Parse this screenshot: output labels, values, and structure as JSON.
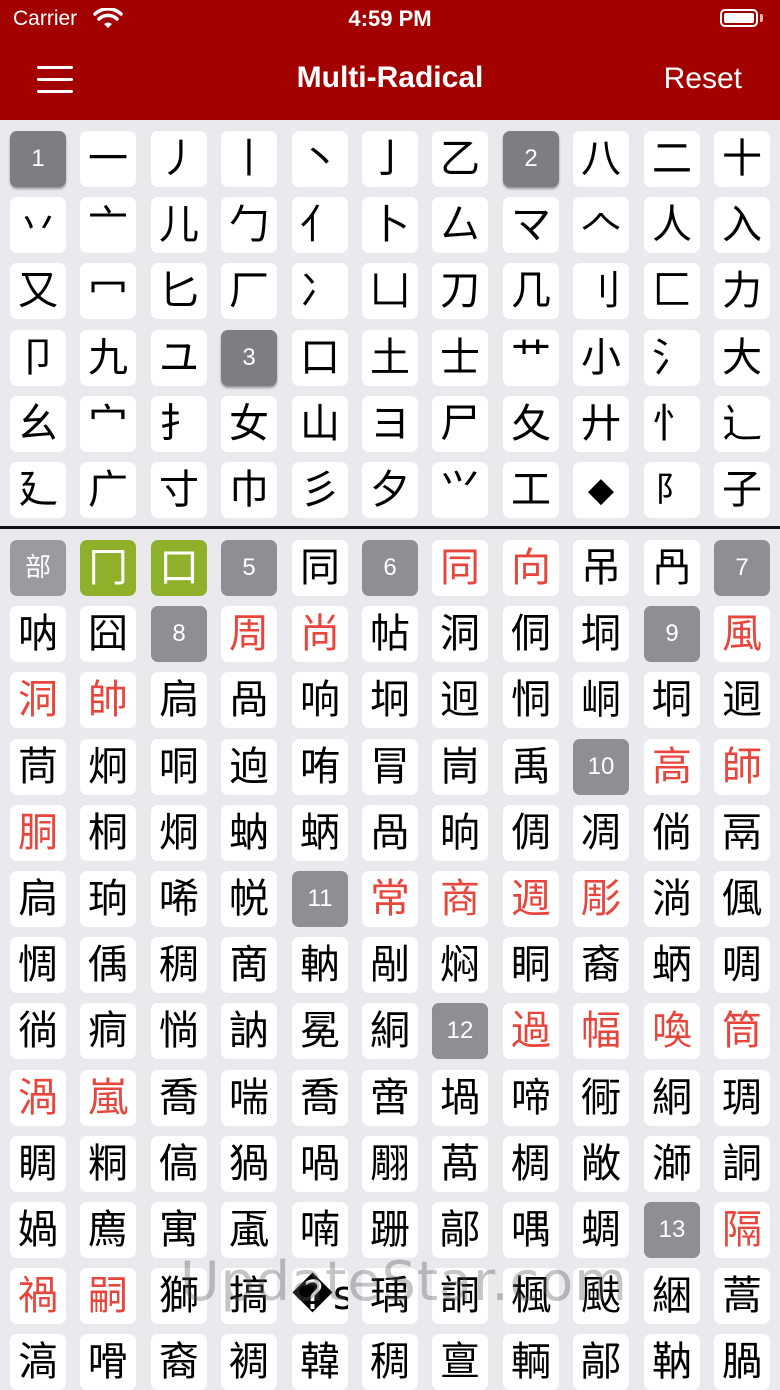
{
  "status_bar": {
    "carrier": "Carrier",
    "time": "4:59 PM"
  },
  "nav": {
    "title": "Multi-Radical",
    "reset_label": "Reset"
  },
  "colors": {
    "header_bg": "#a30000",
    "selected": "#8fb02a",
    "highlight_text": "#e8463c",
    "stroke_badge": "#8e8e93"
  },
  "icons": [
    "wifi-icon",
    "battery-icon",
    "hamburger-menu-icon"
  ],
  "radicals": [
    {
      "c": "1",
      "t": "num"
    },
    {
      "c": "一"
    },
    {
      "c": "丿"
    },
    {
      "c": "丨"
    },
    {
      "c": "丶"
    },
    {
      "c": "亅"
    },
    {
      "c": "乙"
    },
    {
      "c": "2",
      "t": "num"
    },
    {
      "c": "八"
    },
    {
      "c": "二"
    },
    {
      "c": "十"
    },
    {
      "c": "丷"
    },
    {
      "c": "亠"
    },
    {
      "c": "儿"
    },
    {
      "c": "勹"
    },
    {
      "c": "亻"
    },
    {
      "c": "卜"
    },
    {
      "c": "厶"
    },
    {
      "c": "マ"
    },
    {
      "c": "𠆢"
    },
    {
      "c": "人"
    },
    {
      "c": "入"
    },
    {
      "c": "又"
    },
    {
      "c": "冖"
    },
    {
      "c": "匕"
    },
    {
      "c": "厂"
    },
    {
      "c": "冫"
    },
    {
      "c": "凵"
    },
    {
      "c": "刀"
    },
    {
      "c": "几"
    },
    {
      "c": "刂"
    },
    {
      "c": "匚"
    },
    {
      "c": "力"
    },
    {
      "c": "卩"
    },
    {
      "c": "九"
    },
    {
      "c": "ユ"
    },
    {
      "c": "3",
      "t": "num"
    },
    {
      "c": "口"
    },
    {
      "c": "土"
    },
    {
      "c": "士"
    },
    {
      "c": "艹"
    },
    {
      "c": "小"
    },
    {
      "c": "氵"
    },
    {
      "c": "大"
    },
    {
      "c": "幺"
    },
    {
      "c": "宀"
    },
    {
      "c": "扌"
    },
    {
      "c": "女"
    },
    {
      "c": "山"
    },
    {
      "c": "ヨ"
    },
    {
      "c": "尸"
    },
    {
      "c": "夂"
    },
    {
      "c": "廾"
    },
    {
      "c": "忄"
    },
    {
      "c": "辶"
    },
    {
      "c": "廴"
    },
    {
      "c": "广"
    },
    {
      "c": "寸"
    },
    {
      "c": "巾"
    },
    {
      "c": "彡"
    },
    {
      "c": "夕"
    },
    {
      "c": "⺍"
    },
    {
      "c": "工"
    },
    {
      "c": "◆阝"
    },
    {
      "c": "阝◆"
    },
    {
      "c": "子"
    }
  ],
  "results": [
    {
      "c": "部",
      "t": "bu"
    },
    {
      "c": "冂",
      "t": "sel"
    },
    {
      "c": "口",
      "t": "sel"
    },
    {
      "c": "5",
      "t": "num"
    },
    {
      "c": "同"
    },
    {
      "c": "6",
      "t": "num"
    },
    {
      "c": "同",
      "t": "red"
    },
    {
      "c": "向",
      "t": "red"
    },
    {
      "c": "吊"
    },
    {
      "c": "冎"
    },
    {
      "c": "7",
      "t": "num"
    },
    {
      "c": "呐"
    },
    {
      "c": "囧"
    },
    {
      "c": "8",
      "t": "num"
    },
    {
      "c": "周",
      "t": "red"
    },
    {
      "c": "尚",
      "t": "red"
    },
    {
      "c": "帖"
    },
    {
      "c": "洞"
    },
    {
      "c": "侗"
    },
    {
      "c": "垌"
    },
    {
      "c": "9",
      "t": "num"
    },
    {
      "c": "風",
      "t": "red"
    },
    {
      "c": "洞",
      "t": "red"
    },
    {
      "c": "帥",
      "t": "red"
    },
    {
      "c": "扃"
    },
    {
      "c": "咼"
    },
    {
      "c": "响"
    },
    {
      "c": "坰"
    },
    {
      "c": "迥"
    },
    {
      "c": "恫"
    },
    {
      "c": "峒"
    },
    {
      "c": "垌"
    },
    {
      "c": "迵"
    },
    {
      "c": "茼"
    },
    {
      "c": "炯"
    },
    {
      "c": "哃"
    },
    {
      "c": "逈"
    },
    {
      "c": "哊"
    },
    {
      "c": "冐"
    },
    {
      "c": "峝"
    },
    {
      "c": "禹"
    },
    {
      "c": "10",
      "t": "num"
    },
    {
      "c": "高",
      "t": "red"
    },
    {
      "c": "師",
      "t": "red"
    },
    {
      "c": "胴",
      "t": "red"
    },
    {
      "c": "桐"
    },
    {
      "c": "烔"
    },
    {
      "c": "蚋"
    },
    {
      "c": "蛃"
    },
    {
      "c": "咼"
    },
    {
      "c": "晌"
    },
    {
      "c": "倜"
    },
    {
      "c": "凋"
    },
    {
      "c": "倘"
    },
    {
      "c": "鬲"
    },
    {
      "c": "扃"
    },
    {
      "c": "珦"
    },
    {
      "c": "唏"
    },
    {
      "c": "帨"
    },
    {
      "c": "11",
      "t": "num"
    },
    {
      "c": "常",
      "t": "red"
    },
    {
      "c": "商",
      "t": "red"
    },
    {
      "c": "週",
      "t": "red"
    },
    {
      "c": "彫",
      "t": "red"
    },
    {
      "c": "淌"
    },
    {
      "c": "偑"
    },
    {
      "c": "惆"
    },
    {
      "c": "偊"
    },
    {
      "c": "稠"
    },
    {
      "c": "啇"
    },
    {
      "c": "軜"
    },
    {
      "c": "剮"
    },
    {
      "c": "焖"
    },
    {
      "c": "眮"
    },
    {
      "c": "裔"
    },
    {
      "c": "蛃"
    },
    {
      "c": "啁"
    },
    {
      "c": "徜"
    },
    {
      "c": "痌"
    },
    {
      "c": "惝"
    },
    {
      "c": "訥"
    },
    {
      "c": "冕"
    },
    {
      "c": "絧"
    },
    {
      "c": "12",
      "t": "num"
    },
    {
      "c": "過",
      "t": "red"
    },
    {
      "c": "幅",
      "t": "red"
    },
    {
      "c": "喚",
      "t": "red"
    },
    {
      "c": "筒",
      "t": "red"
    },
    {
      "c": "渦",
      "t": "red"
    },
    {
      "c": "嵐",
      "t": "red"
    },
    {
      "c": "喬"
    },
    {
      "c": "喘"
    },
    {
      "c": "喬"
    },
    {
      "c": "啻"
    },
    {
      "c": "堝"
    },
    {
      "c": "啼"
    },
    {
      "c": "衕"
    },
    {
      "c": "絧"
    },
    {
      "c": "琱"
    },
    {
      "c": "睭"
    },
    {
      "c": "粡"
    },
    {
      "c": "傐"
    },
    {
      "c": "猧"
    },
    {
      "c": "喎"
    },
    {
      "c": "翢"
    },
    {
      "c": "萵"
    },
    {
      "c": "椆"
    },
    {
      "c": "敞"
    },
    {
      "c": "溮"
    },
    {
      "c": "詷"
    },
    {
      "c": "媧"
    },
    {
      "c": "廌"
    },
    {
      "c": "寓"
    },
    {
      "c": "颪"
    },
    {
      "c": "喃"
    },
    {
      "c": "跚"
    },
    {
      "c": "鄗"
    },
    {
      "c": "喁"
    },
    {
      "c": "蜩"
    },
    {
      "c": "13",
      "t": "num"
    },
    {
      "c": "隔",
      "t": "red"
    },
    {
      "c": "禍",
      "t": "red"
    },
    {
      "c": "嗣",
      "t": "red"
    },
    {
      "c": "獅"
    },
    {
      "c": "搞"
    },
    {
      "c": "�str"
    },
    {
      "c": "瑀"
    },
    {
      "c": "詷"
    },
    {
      "c": "楓"
    },
    {
      "c": "颫"
    },
    {
      "c": "綑"
    },
    {
      "c": "蒿"
    },
    {
      "c": "滈"
    },
    {
      "c": "嗗"
    },
    {
      "c": "裔"
    },
    {
      "c": "裯"
    },
    {
      "c": "韓"
    },
    {
      "c": "稠"
    },
    {
      "c": "亶"
    },
    {
      "c": "輌"
    },
    {
      "c": "鄗"
    },
    {
      "c": "靹"
    },
    {
      "c": "腡"
    }
  ],
  "watermark": "UpdateStar.com"
}
